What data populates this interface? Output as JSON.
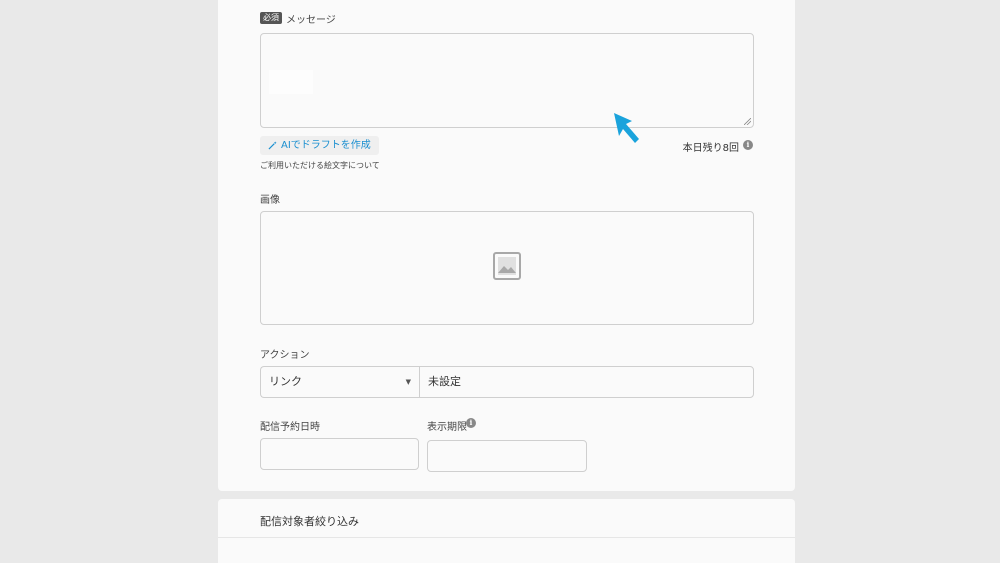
{
  "message": {
    "required_badge": "必須",
    "label": "メッセージ",
    "ai_draft_button": "AIでドラフトを作成",
    "remaining_today": "本日残り8回",
    "emoji_link": "ご利用いただける絵文字について"
  },
  "image": {
    "label": "画像"
  },
  "action": {
    "label": "アクション",
    "type_selected": "リンク",
    "value": "未設定"
  },
  "schedule": {
    "label": "配信予約日時"
  },
  "display_period": {
    "label": "表示期限"
  },
  "filter_section": {
    "title": "配信対象者絞り込み"
  },
  "icons": {
    "info": "info-icon",
    "image_placeholder": "image-placeholder-icon",
    "sparkle": "magic-wand-icon",
    "cursor": "pointer-cursor-icon"
  },
  "colors": {
    "accent": "#1a8fd0",
    "cursor": "#1aa3dc",
    "badge": "#555555"
  }
}
